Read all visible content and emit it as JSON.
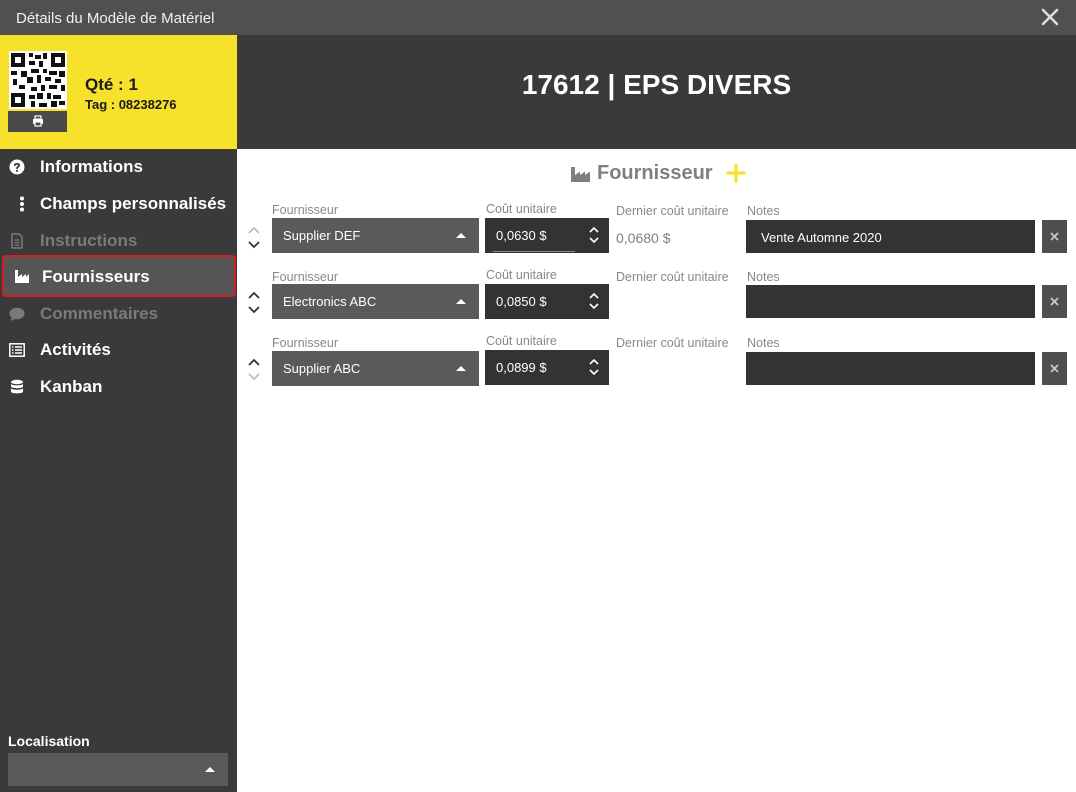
{
  "window": {
    "title": "Détails du Modèle de Matériel"
  },
  "tag_card": {
    "qty": "Qté : 1",
    "tag": "Tag : 08238276"
  },
  "sidebar": {
    "items": [
      {
        "label": "Informations",
        "icon": "question-circle-icon",
        "state": "normal"
      },
      {
        "label": "Champs personnalisés",
        "icon": "ellipsis-vertical-icon",
        "state": "normal"
      },
      {
        "label": "Instructions",
        "icon": "document-icon",
        "state": "disabled"
      },
      {
        "label": "Fournisseurs",
        "icon": "factory-icon",
        "state": "active"
      },
      {
        "label": "Commentaires",
        "icon": "comment-icon",
        "state": "disabled"
      },
      {
        "label": "Activités",
        "icon": "list-icon",
        "state": "normal"
      },
      {
        "label": "Kanban",
        "icon": "database-icon",
        "state": "normal"
      }
    ],
    "location_label": "Localisation",
    "location_value": ""
  },
  "header": {
    "title": "17612 | EPS DIVERS"
  },
  "section": {
    "title": "Fournisseur",
    "icon": "factory-icon",
    "add_icon": "plus-icon",
    "accent": "#f8e12a"
  },
  "labels": {
    "supplier": "Fournisseur",
    "unit_cost": "Coût unitaire",
    "last_cost": "Dernier coût unitaire",
    "notes": "Notes"
  },
  "suppliers": [
    {
      "supplier": "Supplier DEF",
      "unit_cost": "0,0630 $",
      "last_cost": "0,0680 $",
      "notes": "Vente Automne 2020"
    },
    {
      "supplier": "Electronics ABC",
      "unit_cost": "0,0850 $",
      "last_cost": "",
      "notes": ""
    },
    {
      "supplier": "Supplier ABC",
      "unit_cost": "0,0899 $",
      "last_cost": "",
      "notes": ""
    }
  ],
  "colors": {
    "highlight_border": "#d41c24",
    "tag_card_bg": "#f8e12a"
  }
}
